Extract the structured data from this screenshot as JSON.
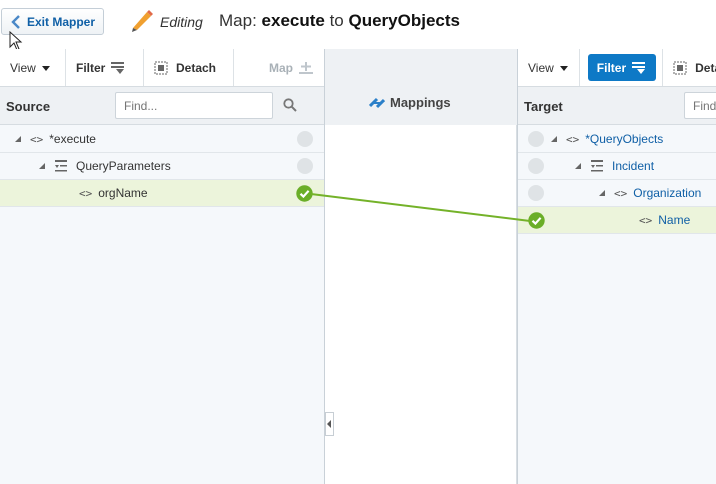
{
  "header": {
    "exit_label": "Exit Mapper",
    "editing_label": "Editing",
    "title_prefix": "Map: ",
    "title_source": "execute",
    "title_mid": " to ",
    "title_target": "QueryObjects"
  },
  "source": {
    "toolbar": {
      "view": "View",
      "filter": "Filter",
      "detach": "Detach",
      "map": "Map"
    },
    "heading": "Source",
    "find_placeholder": "Find...",
    "rows": [
      {
        "label": "*execute"
      },
      {
        "label": "QueryParameters"
      },
      {
        "label": "orgName"
      }
    ]
  },
  "mappings": {
    "label": "Mappings"
  },
  "target": {
    "toolbar": {
      "view": "View",
      "filter": "Filter",
      "detach": "Deta"
    },
    "heading": "Target",
    "find_placeholder": "Find...",
    "rows": [
      {
        "label": "*QueryObjects"
      },
      {
        "label": "Incident"
      },
      {
        "label": "Organization"
      },
      {
        "label": "Name"
      }
    ]
  },
  "colors": {
    "accent": "#0e79c6",
    "link": "#0f5fa6",
    "map_line": "#74b229",
    "selected_row": "#ecf4db"
  }
}
